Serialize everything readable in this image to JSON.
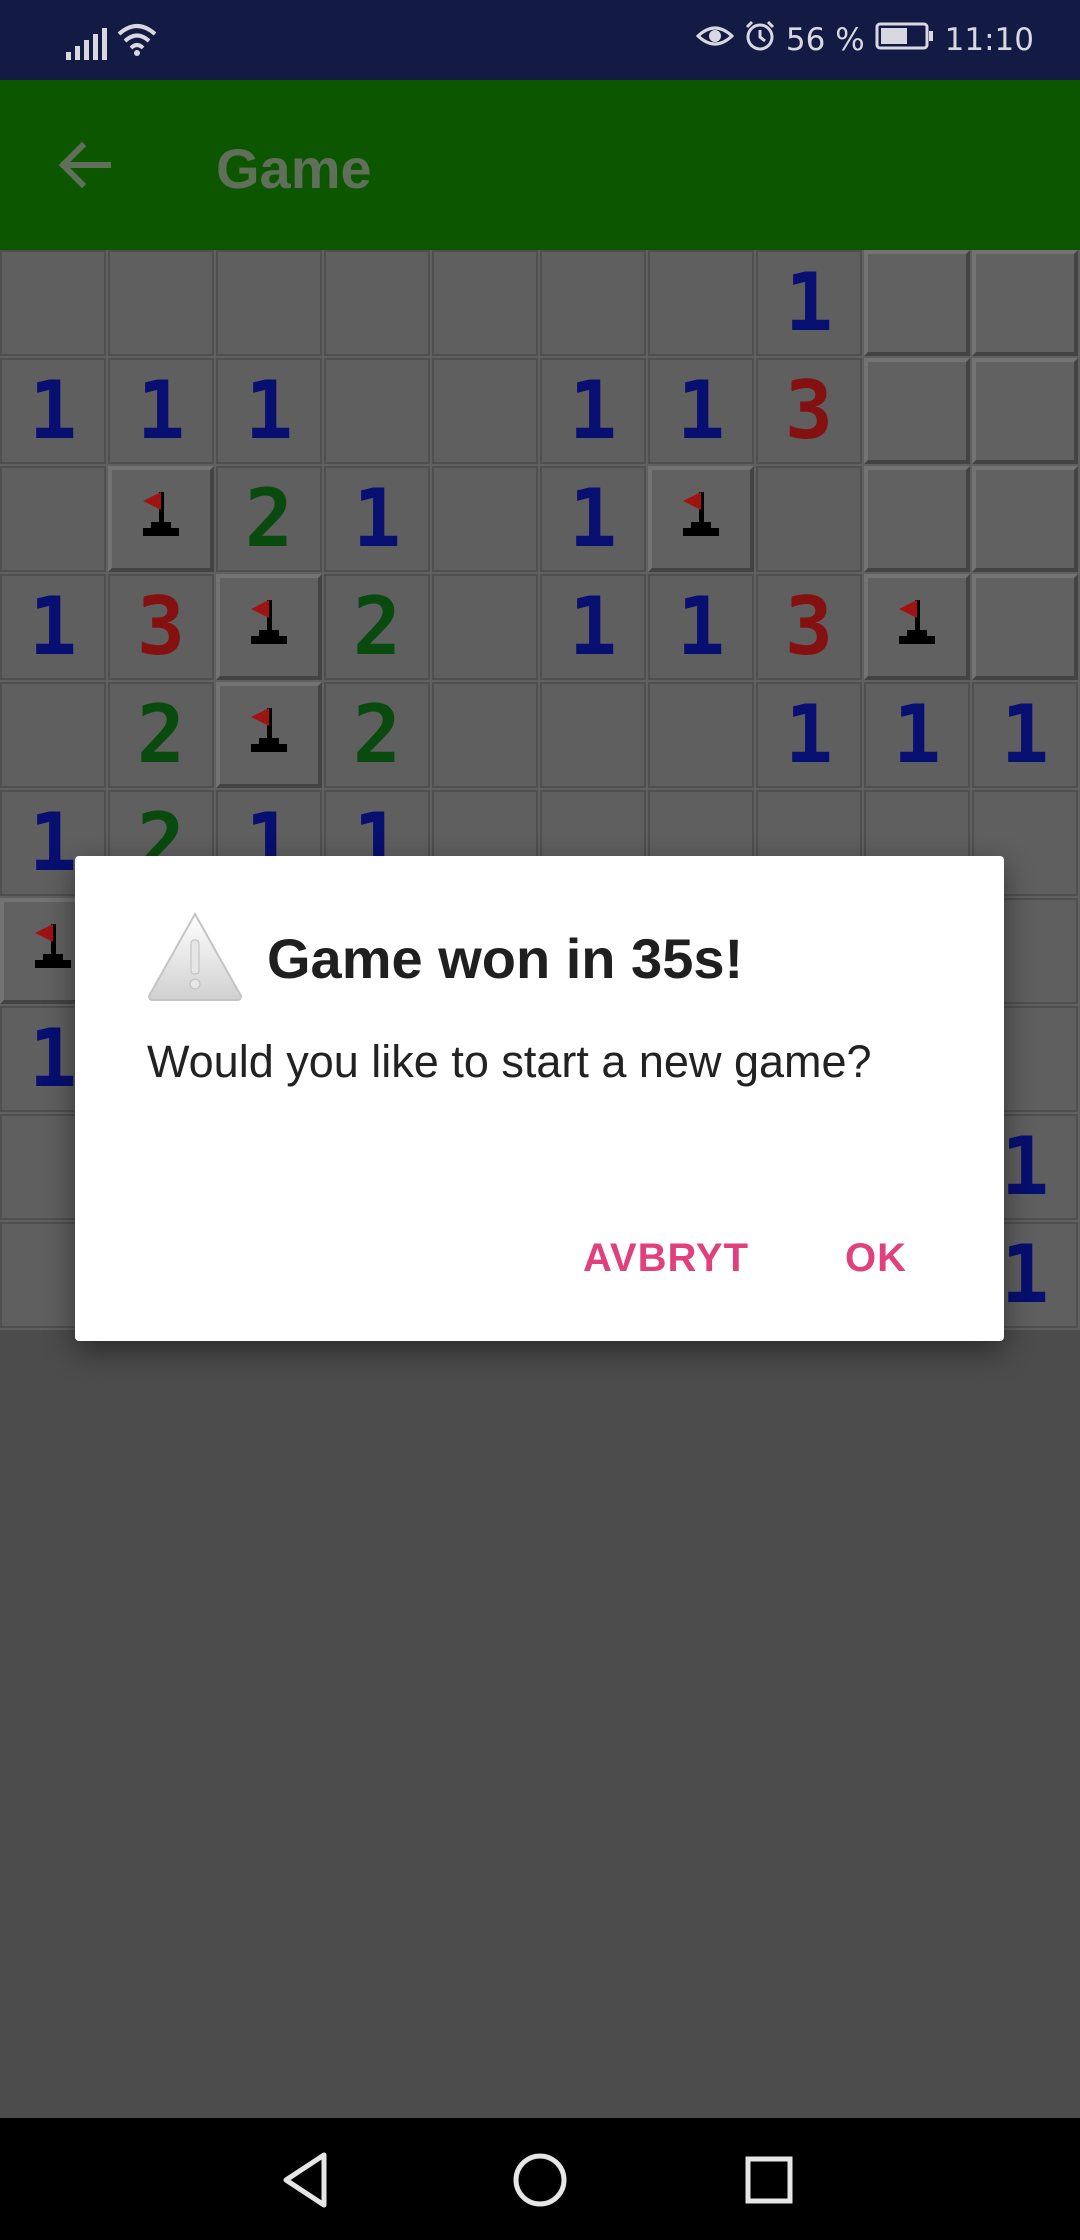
{
  "status_bar": {
    "battery": "56 %",
    "time": "11:10",
    "icons": [
      "signal-icon",
      "wifi-icon",
      "eye-comfort-icon",
      "alarm-icon",
      "battery-icon"
    ]
  },
  "app_bar": {
    "title": "Game",
    "back_icon": "arrow-left-icon",
    "color": "#0d5600"
  },
  "board": {
    "rows": 10,
    "cols": 10,
    "legend": {
      "H": "unrevealed",
      "E": "revealed-empty",
      "F": "flag",
      "1": "number",
      "2": "number",
      "3": "number"
    },
    "grid": [
      [
        "E",
        "E",
        "E",
        "E",
        "E",
        "E",
        "E",
        "1",
        "H",
        "H"
      ],
      [
        "1",
        "1",
        "1",
        "E",
        "E",
        "1",
        "1",
        "3",
        "H",
        "H"
      ],
      [
        "E",
        "F",
        "2",
        "1",
        "E",
        "1",
        "F",
        "E",
        "H",
        "H"
      ],
      [
        "1",
        "3",
        "F",
        "2",
        "E",
        "1",
        "1",
        "3",
        "F",
        "H"
      ],
      [
        "E",
        "2",
        "F",
        "2",
        "E",
        "E",
        "E",
        "1",
        "1",
        "1"
      ],
      [
        "1",
        "2",
        "1",
        "1",
        "E",
        "E",
        "E",
        "E",
        "E",
        "E"
      ],
      [
        "F",
        "H",
        "H",
        "H",
        "H",
        "H",
        "H",
        "H",
        "H",
        "E"
      ],
      [
        "1",
        "H",
        "H",
        "H",
        "H",
        "H",
        "H",
        "H",
        "H",
        "E"
      ],
      [
        "E",
        "E",
        "E",
        "E",
        "E",
        "E",
        "E",
        "E",
        "E",
        "1"
      ],
      [
        "E",
        "E",
        "E",
        "E",
        "E",
        "E",
        "E",
        "E",
        "E",
        "1"
      ]
    ],
    "number_colors": {
      "1": "#0a1596",
      "2": "#0d6413",
      "3": "#b01616"
    }
  },
  "dialog": {
    "icon": "warning-icon",
    "title": "Game won in 35s!",
    "message": "Would you like to start a new game?",
    "cancel_label": "AVBRYT",
    "ok_label": "OK",
    "accent": "#e0417d"
  },
  "nav_bar": {
    "icons": [
      "back-triangle-icon",
      "home-circle-icon",
      "recents-square-icon"
    ]
  }
}
